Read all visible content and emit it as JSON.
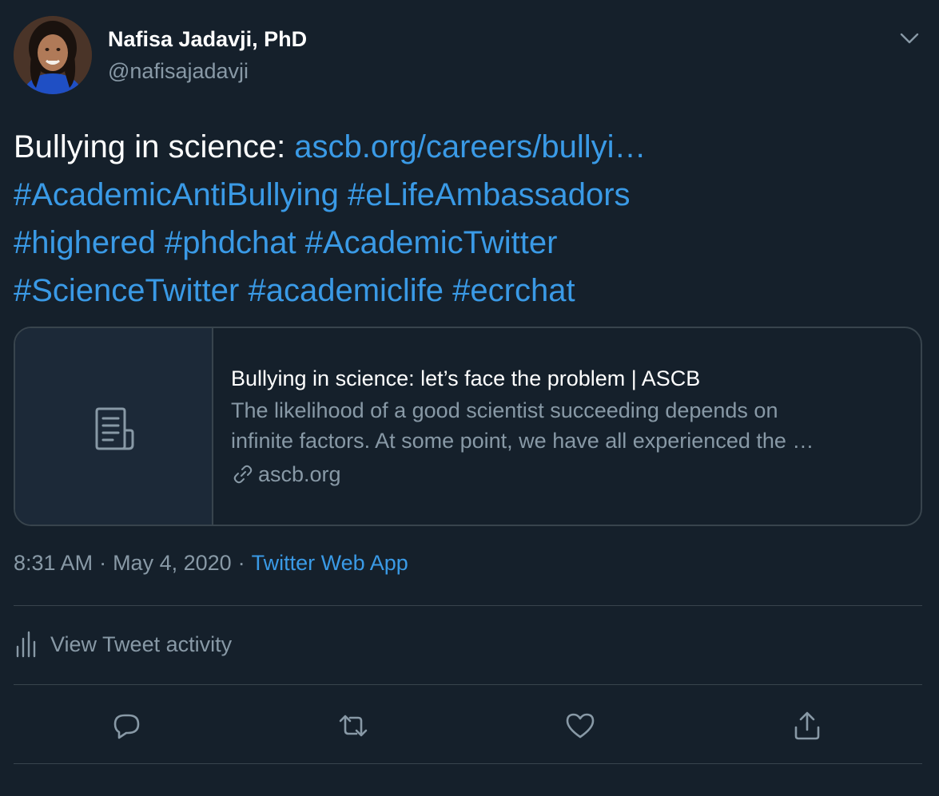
{
  "author": {
    "display_name": "Nafisa Jadavji, PhD",
    "handle": "@nafisajadavji",
    "avatar_icon": "profile-photo"
  },
  "tweet": {
    "text_lead": "Bullying in science: ",
    "url_text": "ascb.org/careers/bullyi…",
    "hashtags_line1": "#AcademicAntiBullying #eLifeAmbassadors",
    "hashtags_line2": "#highered  #phdchat  #AcademicTwitter",
    "hashtags_line3": "#ScienceTwitter  #academiclife #ecrchat"
  },
  "card": {
    "thumb_icon": "document-icon",
    "title": "Bullying in science: let’s face the problem | ASCB",
    "description_line1": "The likelihood of a good scientist succeeding depends on",
    "description_line2": "infinite factors. At some point, we have all experienced the …",
    "domain": "ascb.org"
  },
  "meta": {
    "time": "8:31 AM",
    "separator": "·",
    "date": "May 4, 2020",
    "source": "Twitter Web App"
  },
  "activity": {
    "label": "View Tweet activity"
  },
  "actions": {
    "reply": "reply-icon",
    "retweet": "retweet-icon",
    "like": "heart-icon",
    "share": "share-icon"
  },
  "colors": {
    "background": "#15202b",
    "link": "#3a9ae6",
    "secondary_text": "#8899a6",
    "border": "#38444d"
  }
}
